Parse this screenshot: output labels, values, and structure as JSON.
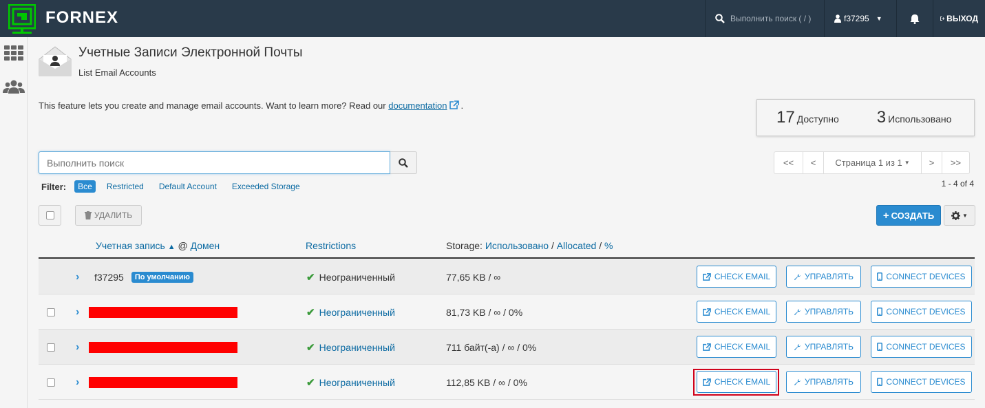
{
  "topbar": {
    "brand": "FORNEX",
    "search_placeholder": "Выполнить поиск ( / )",
    "user": "f37295",
    "logout": "ВЫХОД"
  },
  "page": {
    "title": "Учетные Записи Электронной Почты",
    "subtitle": "List Email Accounts",
    "description_before": "This feature lets you create and manage email accounts. Want to learn more? Read our ",
    "description_link": "documentation",
    "description_after": "."
  },
  "stats": {
    "available_count": "17",
    "available_label": "Доступно",
    "used_count": "3",
    "used_label": "Использовано"
  },
  "search": {
    "placeholder": "Выполнить поиск"
  },
  "filter": {
    "label": "Filter:",
    "items": [
      "Все",
      "Restricted",
      "Default Account",
      "Exceeded Storage"
    ],
    "active": "Все"
  },
  "pagination": {
    "first": "<<",
    "prev": "<",
    "page_label": "Страница 1 из 1",
    "next": ">",
    "last": ">>",
    "range": "1 - 4 of 4"
  },
  "toolbar": {
    "delete_label": "УДАЛИТЬ",
    "create_label": "СОЗДАТЬ"
  },
  "table": {
    "headers": {
      "account": "Учетная запись",
      "at": "@",
      "domain": "Домен",
      "restrictions": "Restrictions",
      "storage_prefix": "Storage:",
      "storage_used": "Использовано",
      "storage_sep1": "/",
      "storage_allocated": "Allocated",
      "storage_sep2": "/",
      "storage_pct": "%"
    },
    "rows": [
      {
        "account": "f37295",
        "badge": "По умолчанию",
        "restriction": "Неограниченный",
        "storage": "77,65 KB / ∞",
        "redacted": false,
        "has_checkbox": false
      },
      {
        "account": "",
        "badge": "",
        "restriction": "Неограниченный",
        "storage": "81,73 KB / ∞ / 0%",
        "redacted": true,
        "has_checkbox": true
      },
      {
        "account": "",
        "badge": "",
        "restriction": "Неограниченный",
        "storage": "711 байт(-а) / ∞ / 0%",
        "redacted": true,
        "has_checkbox": true
      },
      {
        "account": "",
        "badge": "",
        "restriction": "Неограниченный",
        "storage": "112,85 KB / ∞ / 0%",
        "redacted": true,
        "has_checkbox": true
      }
    ],
    "actions": {
      "check_email": "CHECK EMAIL",
      "manage": "УПРАВЛЯТЬ",
      "connect": "CONNECT DEVICES"
    }
  },
  "colors": {
    "topbar": "#293a4a",
    "accent": "#2a8bd0",
    "logo": "#00c800",
    "highlight": "#d0021b",
    "redaction": "#ff0000"
  }
}
